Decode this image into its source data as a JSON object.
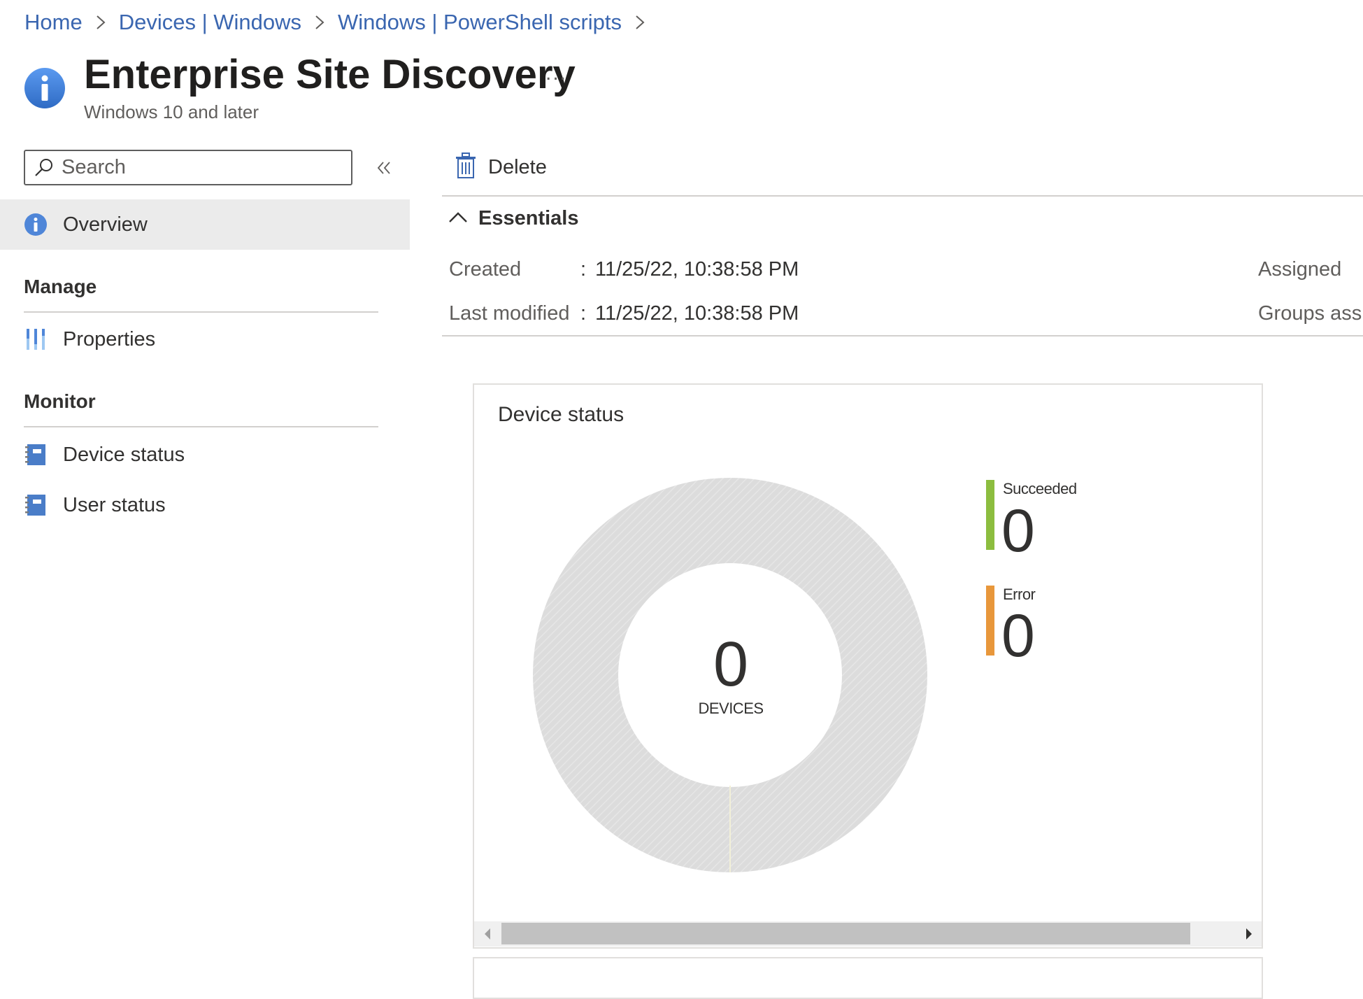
{
  "breadcrumb": [
    {
      "label": "Home"
    },
    {
      "label": "Devices | Windows"
    },
    {
      "label": "Windows | PowerShell scripts"
    }
  ],
  "header": {
    "title": "Enterprise Site Discovery",
    "subtitle": "Windows 10 and later",
    "more_label": "..."
  },
  "nav": {
    "search_placeholder": "Search",
    "overview_label": "Overview",
    "sections": [
      {
        "title": "Manage",
        "items": [
          {
            "label": "Properties",
            "icon": "properties-icon"
          }
        ]
      },
      {
        "title": "Monitor",
        "items": [
          {
            "label": "Device status",
            "icon": "notebook-icon"
          },
          {
            "label": "User status",
            "icon": "notebook-icon"
          }
        ]
      }
    ]
  },
  "toolbar": {
    "delete_label": "Delete"
  },
  "essentials": {
    "title": "Essentials",
    "rows": [
      {
        "key": "Created",
        "value": "11/25/22, 10:38:58 PM"
      },
      {
        "key": "Last modified",
        "value": "11/25/22, 10:38:58 PM"
      }
    ],
    "right_keys": [
      "Assigned",
      "Groups assi"
    ]
  },
  "device_status": {
    "title": "Device status",
    "total": "0",
    "total_label": "DEVICES",
    "legend": [
      {
        "label": "Succeeded",
        "value": "0",
        "color": "#8cbd3f"
      },
      {
        "label": "Error",
        "value": "0",
        "color": "#e8973b"
      }
    ]
  },
  "colors": {
    "accent": "#3a66b0",
    "icon_blue": "#4f86d8"
  }
}
